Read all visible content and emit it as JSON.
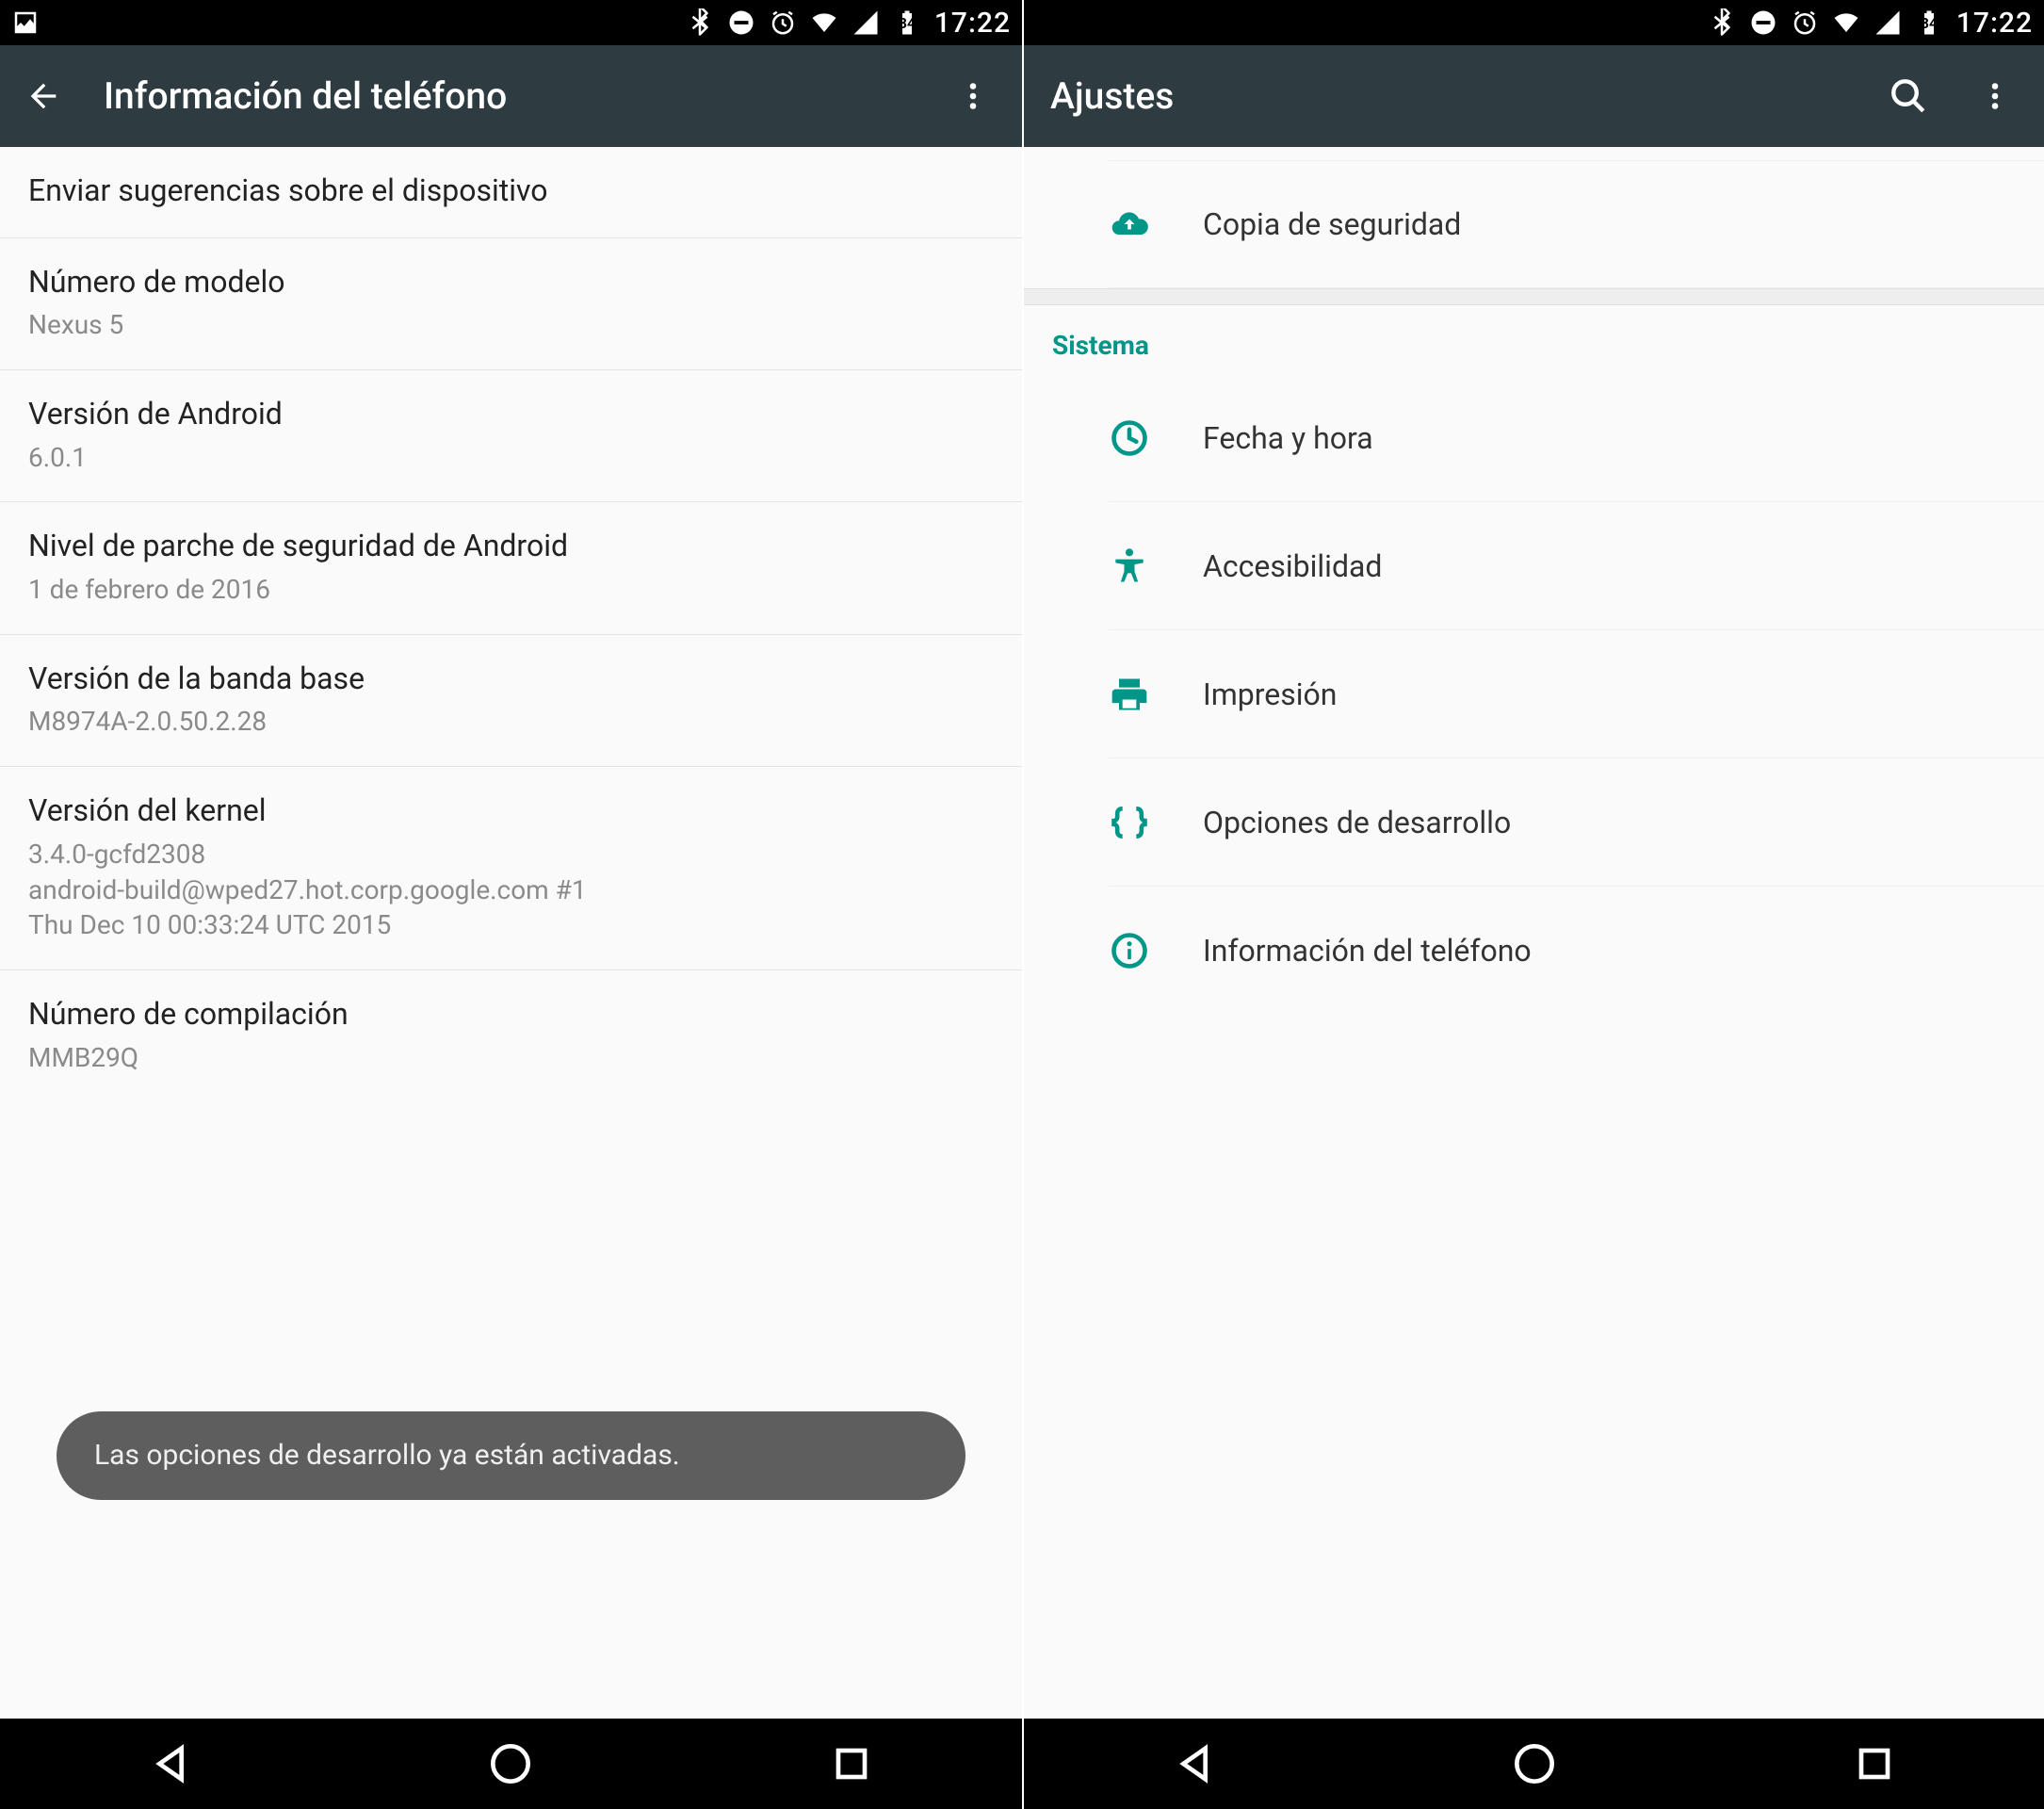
{
  "status": {
    "battery_level": "84",
    "time": "17:22"
  },
  "left": {
    "appbar_title": "Información del teléfono",
    "items": [
      {
        "title": "Enviar sugerencias sobre el dispositivo",
        "subtitle": ""
      },
      {
        "title": "Número de modelo",
        "subtitle": "Nexus 5"
      },
      {
        "title": "Versión de Android",
        "subtitle": "6.0.1"
      },
      {
        "title": "Nivel de parche de seguridad de Android",
        "subtitle": "1 de febrero de 2016"
      },
      {
        "title": "Versión de la banda base",
        "subtitle": "M8974A-2.0.50.2.28"
      },
      {
        "title": "Versión del kernel",
        "subtitle_lines": [
          "3.4.0-gcfd2308",
          "android-build@wped27.hot.corp.google.com #1",
          "Thu Dec 10 00:33:24 UTC 2015"
        ]
      },
      {
        "title": "Número de compilación",
        "subtitle": "MMB29Q"
      }
    ],
    "toast": "Las opciones de desarrollo ya están activadas."
  },
  "right": {
    "appbar_title": "Ajustes",
    "top_item": {
      "label": "Copia de seguridad",
      "icon": "cloud-upload"
    },
    "section_header": "Sistema",
    "items": [
      {
        "label": "Fecha y hora",
        "icon": "clock"
      },
      {
        "label": "Accesibilidad",
        "icon": "accessibility"
      },
      {
        "label": "Impresión",
        "icon": "print"
      },
      {
        "label": "Opciones de desarrollo",
        "icon": "braces"
      },
      {
        "label": "Información del teléfono",
        "icon": "info"
      }
    ]
  },
  "colors": {
    "accent": "#009688",
    "appbar": "#2e3c42"
  }
}
